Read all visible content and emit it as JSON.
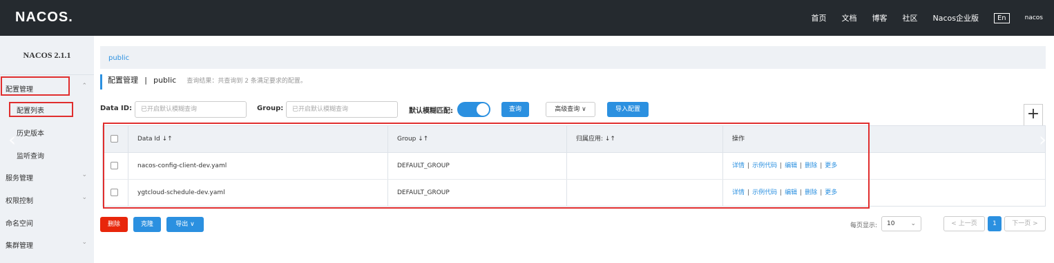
{
  "header": {
    "logo": "NACOS.",
    "nav": [
      "首页",
      "文档",
      "博客",
      "社区",
      "Nacos企业版"
    ],
    "lang": "En",
    "user": "nacos"
  },
  "sidebar": {
    "version": "NACOS 2.1.1",
    "items": [
      {
        "label": "配置管理",
        "chev": "^"
      },
      {
        "label": "配置列表"
      },
      {
        "label": "历史版本"
      },
      {
        "label": "监听查询"
      },
      {
        "label": "服务管理",
        "chev": "v"
      },
      {
        "label": "权限控制",
        "chev": "v"
      },
      {
        "label": "命名空间"
      },
      {
        "label": "集群管理",
        "chev": "v"
      }
    ]
  },
  "breadcrumb": {
    "namespace": "public"
  },
  "title": {
    "main": "配置管理",
    "divider": "|",
    "ns": "public",
    "note": "查询结果：共查询到 2 条满足要求的配置。"
  },
  "filters": {
    "data_id_label": "Data ID:",
    "data_id_placeholder": "已开启默认模糊查询",
    "group_label": "Group:",
    "group_placeholder": "已开启默认模糊查询",
    "fuzzy_label": "默认模糊匹配:",
    "fuzzy_on": true,
    "query_btn": "查询",
    "advanced_btn": "高级查询 ∨",
    "import_btn": "导入配置",
    "add_btn": "+"
  },
  "table": {
    "headers": [
      "Data Id ↓↑",
      "Group ↓↑",
      "归属应用: ↓↑",
      "操作"
    ],
    "rows": [
      {
        "data_id": "nacos-config-client-dev.yaml",
        "group": "DEFAULT_GROUP",
        "app": ""
      },
      {
        "data_id": "ygtcloud-schedule-dev.yaml",
        "group": "DEFAULT_GROUP",
        "app": ""
      }
    ],
    "ops": [
      "详情",
      "示例代码",
      "编辑",
      "删除",
      "更多"
    ]
  },
  "bulk": {
    "delete": "删除",
    "clone": "克隆",
    "export": "导出 ∨"
  },
  "pagination": {
    "per_page_label": "每页显示:",
    "per_page": "10",
    "prev": "< 上一页",
    "current": "1",
    "next": "下一页 >"
  },
  "colors": {
    "topbar": "#252a2f",
    "accent": "#2b90e0",
    "danger": "#e8260b",
    "highlight": "#e02d2d"
  }
}
